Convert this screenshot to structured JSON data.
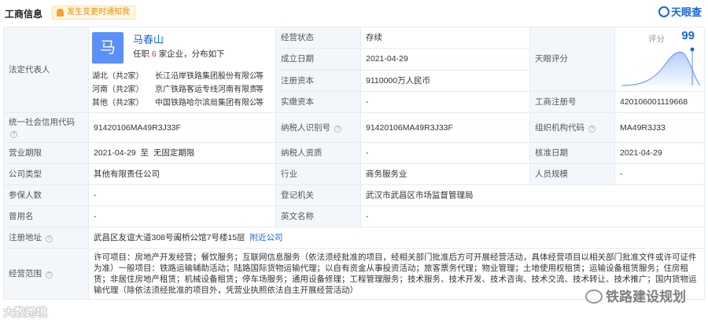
{
  "header": {
    "title": "工商信息",
    "notify_label": "发生变更时通知我",
    "brand": "天眼查"
  },
  "rep": {
    "label": "法定代表人",
    "avatar": "马",
    "name": "马春山",
    "sub_prefix": "任职",
    "sub_count": "6",
    "sub_suffix": "家企业，分布如下",
    "regions": [
      {
        "region": "湖北（共2家）",
        "company": "长江沿岸铁路集团股份有限公司",
        "more": "等"
      },
      {
        "region": "河南（共2家）",
        "company": "京广铁路客运专线河南有限责任公司",
        "more": "等"
      },
      {
        "region": "其他（共2家）",
        "company": "中国铁路哈尔滨局集团有限公司",
        "more": "等"
      }
    ]
  },
  "fields": {
    "status_label": "经营状态",
    "status_value": "存续",
    "founded_label": "成立日期",
    "founded_value": "2021-04-29",
    "capital_label": "注册资本",
    "capital_value": "9110000万人民币",
    "paid_label": "实缴资本",
    "paid_value": "-",
    "score_label": "天眼评分",
    "score_small_label": "评分",
    "score_value": "99",
    "regno_label": "工商注册号",
    "regno_value": "420106001119668",
    "credit_label": "统一社会信用代码",
    "credit_value": "91420106MA49R3J33F",
    "taxid_label": "纳税人识别号",
    "taxid_value": "91420106MA49R3J33F",
    "orgcode_label": "组织机构代码",
    "orgcode_value": "MA49R3J33",
    "term_label": "营业期限",
    "term_value": "2021-04-29  至  无固定期限",
    "taxq_label": "纳税人资质",
    "taxq_value": "-",
    "approve_label": "核准日期",
    "approve_value": "2021-04-29",
    "type_label": "公司类型",
    "type_value": "其他有限责任公司",
    "industry_label": "行业",
    "industry_value": "商务服务业",
    "staff_label": "人员规模",
    "staff_value": "-",
    "insured_label": "参保人数",
    "insured_value": "-",
    "authority_label": "登记机关",
    "authority_value": "武汉市武昌区市场监督管理局",
    "former_label": "曾用名",
    "former_value": "-",
    "en_label": "英文名称",
    "en_value": "-",
    "address_label": "注册地址",
    "address_value": "武昌区友谊大道308号阖桥公馆7号楼15层",
    "address_link": "附近公司",
    "scope_label": "经营范围",
    "scope_value": "许可项目：房地产开发经营；餐饮服务；互联网信息服务（依法须经批准的项目，经相关部门批准后方可开展经营活动，具体经营项目以相关部门批准文件或许可证件为准）一般项目：铁路运输辅助活动；陆路国际货物运输代理；以自有资金从事投资活动；旅客票务代理；物业管理；土地使用权租赁；运输设备租赁服务；住房租赁；非居住房地产租赁；机械设备租赁；停车场服务；通用设备修理；工程管理服务；技术服务、技术开发、技术咨询、技术交流、技术转让、技术推广；国内货物运输代理（除依法须经批准的项目外，凭营业执照依法自主开展经营活动）"
  },
  "watermarks": {
    "left": "大数跨境",
    "right": "铁路建设规划"
  },
  "colors": {
    "accent": "#1668dc",
    "label_bg": "#f3f7fc",
    "count_red": "#f5222d",
    "notify_orange": "#f08c00"
  }
}
